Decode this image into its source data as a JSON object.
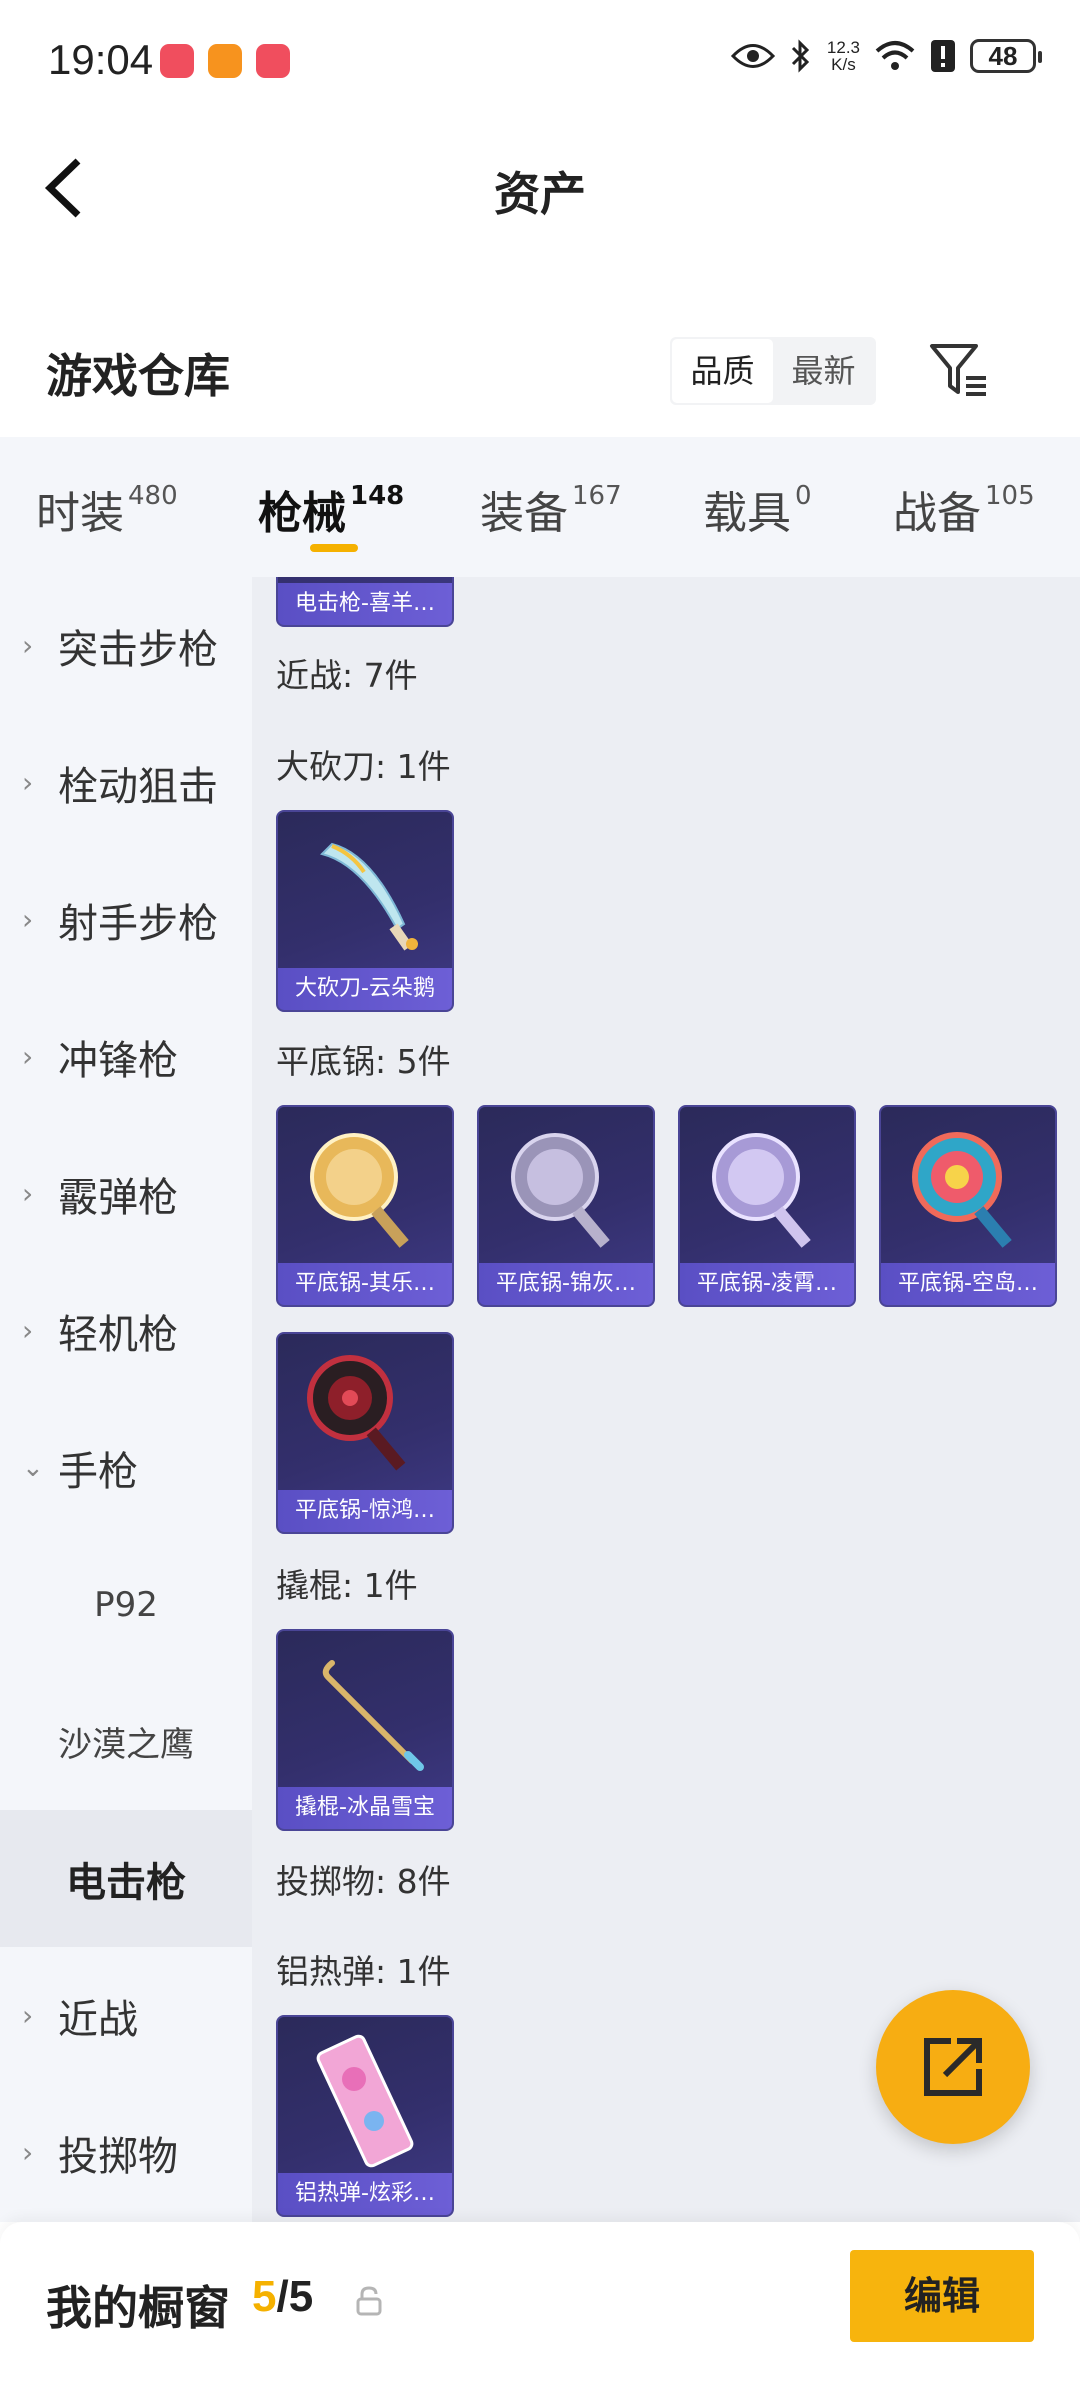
{
  "status_bar": {
    "time": "19:04",
    "net_speed": "12.3",
    "net_unit": "K/s",
    "battery": "48"
  },
  "header": {
    "title": "资产"
  },
  "warehouse": {
    "title": "游戏仓库",
    "sort_options": [
      "品质",
      "最新"
    ],
    "active_sort": "品质"
  },
  "categories": [
    {
      "label": "时装",
      "count": "480"
    },
    {
      "label": "枪械",
      "count": "148"
    },
    {
      "label": "装备",
      "count": "167"
    },
    {
      "label": "载具",
      "count": "0"
    },
    {
      "label": "战备",
      "count": "105"
    }
  ],
  "active_category": "枪械",
  "sidebar": {
    "items": [
      {
        "label": "突击步枪"
      },
      {
        "label": "栓动狙击"
      },
      {
        "label": "射手步枪"
      },
      {
        "label": "冲锋枪"
      },
      {
        "label": "霰弹枪"
      },
      {
        "label": "轻机枪"
      },
      {
        "label": "手枪"
      },
      {
        "label": "P92"
      },
      {
        "label": "沙漠之鹰"
      },
      {
        "label": "电击枪"
      },
      {
        "label": "近战"
      },
      {
        "label": "投掷物"
      }
    ]
  },
  "content": {
    "partial_card": "电击枪-喜羊…",
    "groups": [
      {
        "label": "近战: 7件"
      },
      {
        "label": "大砍刀: 1件",
        "items": [
          "大砍刀-云朵鹅"
        ]
      },
      {
        "label": "平底锅: 5件",
        "items": [
          "平底锅-其乐…",
          "平底锅-锦灰…",
          "平底锅-凌霄…",
          "平底锅-空岛…",
          "平底锅-惊鸿…"
        ]
      },
      {
        "label": "撬棍: 1件",
        "items": [
          "撬棍-冰晶雪宝"
        ]
      },
      {
        "label": "投掷物: 8件"
      },
      {
        "label": "铝热弹: 1件",
        "items": [
          "铝热弹-炫彩…"
        ]
      }
    ]
  },
  "bottom_bar": {
    "title": "我的橱窗",
    "current": "5",
    "total": "/5",
    "edit_label": "编辑"
  },
  "colors": {
    "accent": "#f7b40d",
    "card_bg": "#332f6c",
    "card_label": "#6d5fd6"
  }
}
